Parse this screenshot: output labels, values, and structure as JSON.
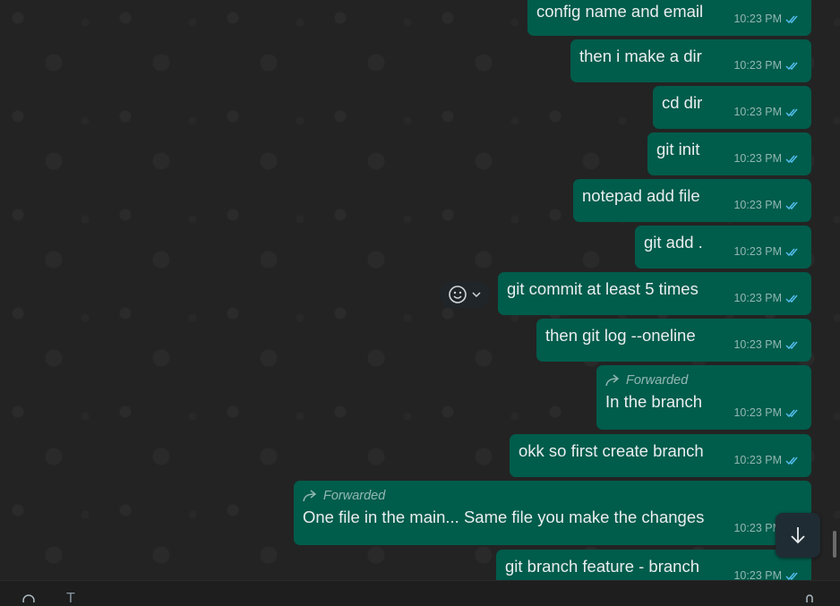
{
  "messages": [
    {
      "text": "config name and email",
      "time": "10:23 PM",
      "forwarded": false
    },
    {
      "text": "then i make a dir",
      "time": "10:23 PM",
      "forwarded": false
    },
    {
      "text": "cd dir",
      "time": "10:23 PM",
      "forwarded": false
    },
    {
      "text": "git init",
      "time": "10:23 PM",
      "forwarded": false
    },
    {
      "text": "notepad add file",
      "time": "10:23 PM",
      "forwarded": false
    },
    {
      "text": "git add .",
      "time": "10:23 PM",
      "forwarded": false
    },
    {
      "text": "git commit at least 5 times",
      "time": "10:23 PM",
      "forwarded": false
    },
    {
      "text": "then git log --oneline",
      "time": "10:23 PM",
      "forwarded": false
    },
    {
      "text": "In the branch",
      "time": "10:23 PM",
      "forwarded": true,
      "forwarded_label": "Forwarded"
    },
    {
      "text": "okk so first create branch",
      "time": "10:23 PM",
      "forwarded": false
    },
    {
      "text": "One file in the main... Same file you make the changes",
      "time": "10:23 PM",
      "forwarded": true,
      "forwarded_label": "Forwarded"
    },
    {
      "text": "git branch feature - branch",
      "time": "10:23 PM",
      "forwarded": false
    }
  ],
  "composer": {
    "placeholder": "T"
  },
  "colors": {
    "outgoing_bubble": "#005c4b",
    "tick_read": "#53bdeb",
    "background": "#232323"
  },
  "icons": {
    "reaction": "smiley-icon",
    "reaction_menu": "chevron-down-icon",
    "scroll_down": "arrow-down-icon",
    "forwarded": "forward-arrow-icon",
    "status": "double-check-icon"
  }
}
